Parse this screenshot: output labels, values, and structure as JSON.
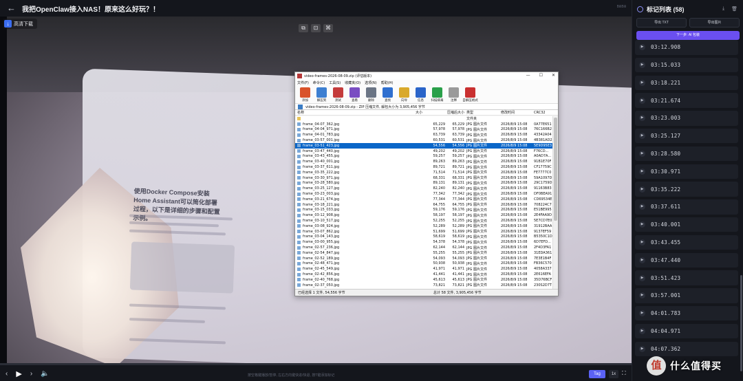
{
  "header": {
    "title": "我把OpenClaw接入NAS！原来这么好玩？！",
    "brand_mini": "BiliBili"
  },
  "video": {
    "source_label": "高清下载",
    "doc_title": "使用Docker Compose安装Home Assistant可以简化部署过程，以下是详细的步骤和配置示例。",
    "float_tools": [
      "⧉",
      "⊡",
      "⌘"
    ]
  },
  "rar": {
    "title": "video-frames-2026-08-09.zip (评估版本)",
    "menu": [
      "文件(F)",
      "命令(C)",
      "工具(S)",
      "收藏夹(O)",
      "选项(N)",
      "帮助(H)"
    ],
    "tools": [
      {
        "label": "添加",
        "color": "#d9532b"
      },
      {
        "label": "解压到",
        "color": "#3d7fd1"
      },
      {
        "label": "测试",
        "color": "#c43b3b"
      },
      {
        "label": "查看",
        "color": "#7a4ec2"
      },
      {
        "label": "删除",
        "color": "#6b7585"
      },
      {
        "label": "查找",
        "color": "#2f6fcf"
      },
      {
        "label": "向导",
        "color": "#d9a92b"
      },
      {
        "label": "信息",
        "color": "#2a64c9"
      },
      {
        "label": "扫描病毒",
        "color": "#2aa04a"
      },
      {
        "label": "注释",
        "color": "#9a9a9a"
      },
      {
        "label": "自解压格式",
        "color": "#c93030"
      }
    ],
    "path": "video-frames-2026-08-09.zip - ZIP 压缩文件, 解包大小为 3,905,456 字节",
    "columns": [
      "名称",
      "大小",
      "压缩后大小",
      "类型",
      "修改时间",
      "CRC32"
    ],
    "folder_type": "文件夹",
    "selected_index": 4,
    "rows": [
      [
        "frame_04-07_362.jpg",
        "65,229",
        "65,229",
        "JPG 图片文件",
        "2026/8/9 15:08",
        "0A77E651"
      ],
      [
        "frame_04-04_971.jpg",
        "57,978",
        "57,978",
        "JPG 图片文件",
        "2026/8/9 15:08",
        "76C166B2"
      ],
      [
        "frame_04-01_783.jpg",
        "63,739",
        "63,739",
        "JPG 图片文件",
        "2026/8/9 15:08",
        "43342A04"
      ],
      [
        "frame_03-57_001.jpg",
        "60,531",
        "60,531",
        "JPG 图片文件",
        "2026/8/9 15:08",
        "4B381AD2"
      ],
      [
        "frame_03-51_423.jpg",
        "54,556",
        "54,556",
        "JPG 图片文件",
        "2026/8/9 15:08",
        "5E9D95E3"
      ],
      [
        "frame_03-47_440.jpg",
        "49,202",
        "49,202",
        "JPG 图片文件",
        "2026/8/9 15:08",
        "F76CD..."
      ],
      [
        "frame_03-43_455.jpg",
        "59,257",
        "59,257",
        "JPG 图片文件",
        "2026/8/9 15:08",
        "A0AD7A..."
      ],
      [
        "frame_03-40_001.jpg",
        "89,263",
        "89,263",
        "JPG 图片文件",
        "2026/8/9 15:08",
        "91B1E70F"
      ],
      [
        "frame_03-37_611.jpg",
        "89,721",
        "89,721",
        "JPG 图片文件",
        "2026/8/9 15:08",
        "CF17759C"
      ],
      [
        "frame_03-35_222.jpg",
        "71,514",
        "71,514",
        "JPG 图片文件",
        "2026/8/9 15:08",
        "FE7777C0"
      ],
      [
        "frame_03-30_971.jpg",
        "68,331",
        "68,331",
        "JPG 图片文件",
        "2026/8/9 15:08",
        "59A1097D"
      ],
      [
        "frame_03-28_580.jpg",
        "89,131",
        "89,131",
        "JPG 图片文件",
        "2026/8/9 15:08",
        "29C1759D"
      ],
      [
        "frame_03-25_127.jpg",
        "82,240",
        "82,240",
        "JPG 图片文件",
        "2026/8/9 15:08",
        "91163B83"
      ],
      [
        "frame_03-23_003.jpg",
        "77,342",
        "77,342",
        "JPG 图片文件",
        "2026/8/9 15:08",
        "DF0BEA91"
      ],
      [
        "frame_03-21_674.jpg",
        "77,344",
        "77,344",
        "JPG 图片文件",
        "2026/8/9 15:08",
        "CD69534E"
      ],
      [
        "frame_03-18_221.jpg",
        "64,755",
        "64,755",
        "JPG 图片文件",
        "2026/8/9 15:08",
        "708224C7"
      ],
      [
        "frame_03-15_033.jpg",
        "59,176",
        "59,176",
        "JPG 图片文件",
        "2026/8/9 15:08",
        "E51BE995"
      ],
      [
        "frame_03-12_908.jpg",
        "58,197",
        "58,197",
        "JPG 图片文件",
        "2026/8/9 15:08",
        "2E4FAA9D"
      ],
      [
        "frame_03-10_517.jpg",
        "52,255",
        "52,255",
        "JPG 图片文件",
        "2026/8/9 15:08",
        "5E7CD7E0"
      ],
      [
        "frame_03-08_924.jpg",
        "52,289",
        "52,289",
        "JPG 图片文件",
        "2026/8/9 15:08",
        "31912BAA"
      ],
      [
        "frame_03-07_862.jpg",
        "51,699",
        "51,699",
        "JPG 图片文件",
        "2026/8/9 15:08",
        "9137EF59"
      ],
      [
        "frame_03-04_143.jpg",
        "58,619",
        "58,619",
        "JPG 图片文件",
        "2026/8/9 15:08",
        "B5350C1D"
      ],
      [
        "frame_03-00_955.jpg",
        "54,378",
        "54,378",
        "JPG 图片文件",
        "2026/8/9 15:08",
        "6D7EFD..."
      ],
      [
        "frame_02-57_236.jpg",
        "62,144",
        "62,144",
        "JPG 图片文件",
        "2026/8/9 15:08",
        "2F4D3FA1"
      ],
      [
        "frame_02-54_847.jpg",
        "55,255",
        "55,255",
        "JPG 图片文件",
        "2026/8/9 15:08",
        "31EDA361"
      ],
      [
        "frame_02-52_189.jpg",
        "54,093",
        "54,093",
        "JPG 图片文件",
        "2026/8/9 15:08",
        "7E3E1B4F"
      ],
      [
        "frame_02-48_471.jpg",
        "50,938",
        "50,938",
        "JPG 图片文件",
        "2026/8/9 15:08",
        "FB36C570"
      ],
      [
        "frame_02-45_549.jpg",
        "41,971",
        "41,971",
        "JPG 图片文件",
        "2026/8/9 15:08",
        "4058A337"
      ],
      [
        "frame_02-42_856.jpg",
        "41,441",
        "41,441",
        "JPG 图片文件",
        "2026/8/9 15:08",
        "2E616EFA"
      ],
      [
        "frame_02-40_768.jpg",
        "45,613",
        "45,613",
        "JPG 图片文件",
        "2026/8/9 15:08",
        "35D76BCF"
      ],
      [
        "frame_02-37_050.jpg",
        "73,821",
        "73,821",
        "JPG 图片文件",
        "2026/8/9 15:08",
        "230S2D7T"
      ]
    ],
    "status_left": "已经选择 1 文件, 54,556 字节",
    "status_right": "总计 58 文件, 3,905,456 字节"
  },
  "controls": {
    "progress": 0.0,
    "play": "▶",
    "volume": "🔈",
    "hint": "按空格键播放/暂停, 左右方向键快进/快退, 按T键添加标记",
    "tag_label": "Tag",
    "speed_label": "1x",
    "fullscreen": "⛶"
  },
  "panel": {
    "title": "标记列表 (58)",
    "export_txt": "导出 TXT",
    "export_frames": "导出图片",
    "next_step": "下一步: AI 包装",
    "marks": [
      "03:12.908",
      "03:15.033",
      "03:18.221",
      "03:21.674",
      "03:23.003",
      "03:25.127",
      "03:28.580",
      "03:30.971",
      "03:35.222",
      "03:37.611",
      "03:40.001",
      "03:43.455",
      "03:47.440",
      "03:51.423",
      "03:57.001",
      "04:01.783",
      "04:04.971",
      "04:07.362"
    ]
  },
  "watermark": {
    "logo": "值",
    "text": "什么值得买"
  }
}
